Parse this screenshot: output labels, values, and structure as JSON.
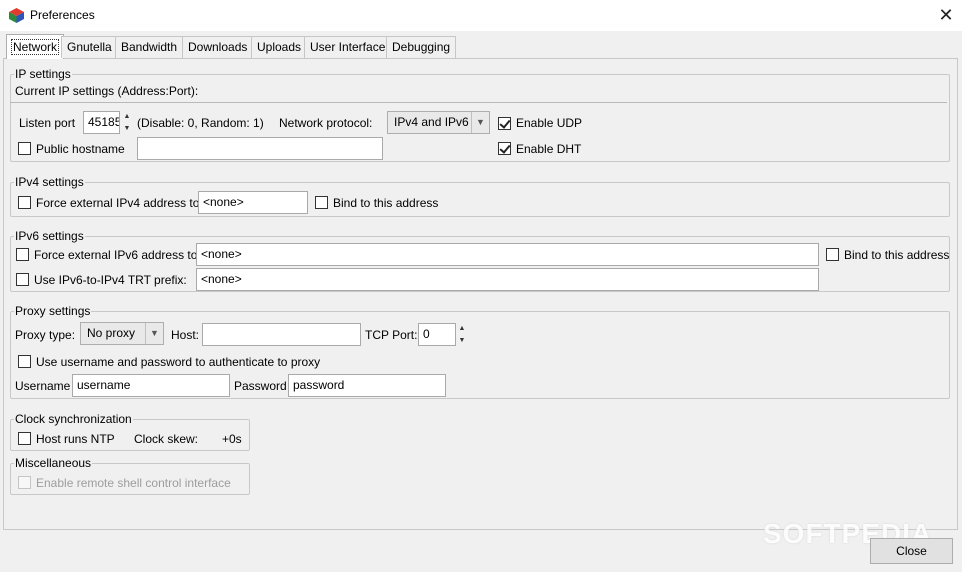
{
  "window": {
    "title": "Preferences"
  },
  "tabs": [
    "Network",
    "Gnutella",
    "Bandwidth",
    "Downloads",
    "Uploads",
    "User Interface",
    "Debugging"
  ],
  "ip_settings": {
    "legend": "IP settings",
    "current_label": "Current IP settings (Address:Port):",
    "listen_port_label": "Listen port",
    "listen_port_value": "45185",
    "port_hint": "(Disable: 0, Random: 1)",
    "protocol_label": "Network protocol:",
    "protocol_value": "IPv4 and IPv6",
    "enable_udp": "Enable UDP",
    "public_hostname": "Public hostname",
    "public_hostname_value": "",
    "enable_dht": "Enable DHT"
  },
  "ipv4_settings": {
    "legend": "IPv4 settings",
    "force_label": "Force external IPv4 address to",
    "address_value": "<none>",
    "bind_label": "Bind to this address"
  },
  "ipv6_settings": {
    "legend": "IPv6 settings",
    "force_label": "Force external IPv6 address to",
    "address_value": "<none>",
    "bind_label": "Bind to this address",
    "trt_label": "Use IPv6-to-IPv4 TRT prefix:",
    "trt_value": "<none>"
  },
  "proxy_settings": {
    "legend": "Proxy settings",
    "type_label": "Proxy type:",
    "type_value": "No proxy",
    "host_label": "Host:",
    "host_value": "",
    "port_label": "TCP Port:",
    "port_value": "0",
    "auth_label": "Use username and password to authenticate to proxy",
    "username_label": "Username",
    "username_value": "username",
    "password_label": "Password",
    "password_value": "password"
  },
  "clock": {
    "legend": "Clock synchronization",
    "ntp_label": "Host runs NTP",
    "skew_label": "Clock skew:",
    "skew_value": "+0s"
  },
  "misc": {
    "legend": "Miscellaneous",
    "remote_shell_label": "Enable remote shell control interface"
  },
  "footer": {
    "close_label": "Close"
  },
  "watermark": "SOFTPEDIA"
}
